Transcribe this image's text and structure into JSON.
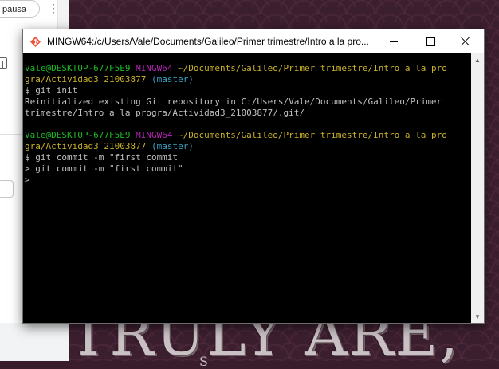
{
  "browser": {
    "pause_chip_label": "pausa",
    "kebab_label": "⋮"
  },
  "wallpaper": {
    "headline": "TRULY ARE,",
    "subline": "S"
  },
  "terminal": {
    "title": "MINGW64:/c/Users/Vale/Documents/Galileo/Primer trimestre/Intro a la pro...",
    "prompt1": {
      "user_host": "Vale@DESKTOP-677F5E9",
      "system": "MINGW64",
      "path_line1": "~/Documents/Galileo/Primer trimestre/Intro a la pro",
      "path_line2": "gra/Actividad3_21003877",
      "branch": "(master)"
    },
    "command1": "$ git init",
    "output1_line1": "Reinitialized existing Git repository in C:/Users/Vale/Documents/Galileo/Primer",
    "output1_line2": "trimestre/Intro a la progra/Actividad3_21003877/.git/",
    "prompt2": {
      "user_host": "Vale@DESKTOP-677F5E9",
      "system": "MINGW64",
      "path_line1": "~/Documents/Galileo/Primer trimestre/Intro a la pro",
      "path_line2": "gra/Actividad3_21003877",
      "branch": "(master)"
    },
    "command2": "$ git commit -m \"first commit",
    "continuation1": "> git commit -m \"first commit\"",
    "continuation2": ">",
    "scroll_up_glyph": "▲",
    "scroll_down_glyph": "▼"
  },
  "colors": {
    "user": "#1cb824",
    "host": "#b426b4",
    "path": "#c9b12a",
    "branch": "#3aa3c4"
  }
}
